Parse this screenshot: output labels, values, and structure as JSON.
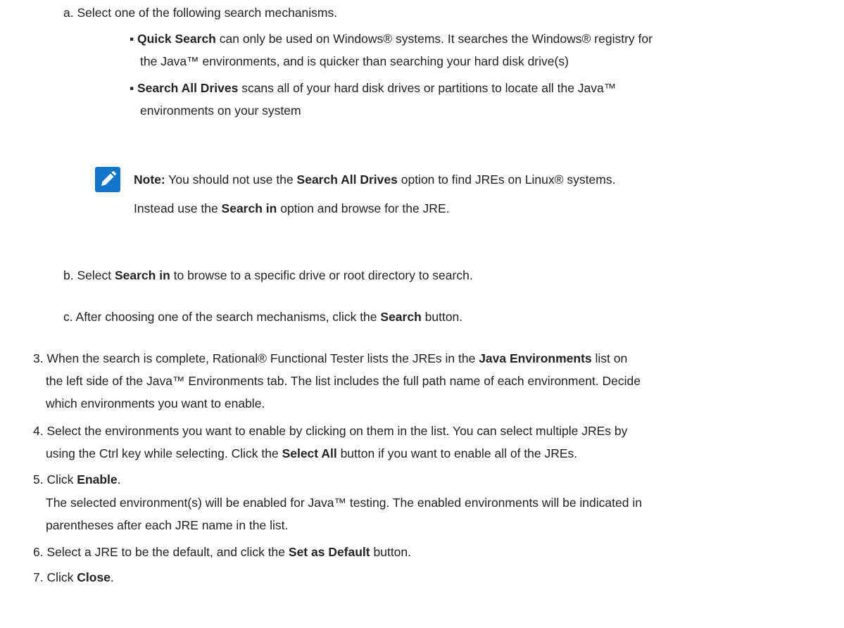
{
  "colors": {
    "text": "#222222",
    "note_icon_bg": "#1576c9"
  },
  "step2_substeps": {
    "a": {
      "marker": "a.",
      "text": "Select one of the following search mechanisms.",
      "options": [
        {
          "term": "Quick Search",
          "line1": " can only be used on Windows® systems. It searches the Windows® registry for",
          "line2": "the Java™ environments, and is quicker than searching your hard disk drive(s)"
        },
        {
          "term": "Search All Drives",
          "line1": " scans all of your hard disk drives or partitions to locate all the Java™",
          "line2": "environments on your system"
        }
      ],
      "note": {
        "icon": "pencil-icon",
        "label": "Note:",
        "t1": " You should not use the ",
        "b1": "Search All Drives",
        "t2": " option to find JREs on Linux® systems.",
        "t3": "Instead use the ",
        "b2": "Search in",
        "t4": " option and browse for the JRE."
      }
    },
    "b": {
      "marker": "b.",
      "t1": "Select ",
      "b1": "Search in",
      "t2": " to browse to a specific drive or root directory to search."
    },
    "c": {
      "marker": "c.",
      "t1": "After choosing one of the search mechanisms, click the ",
      "b1": "Search",
      "t2": " button."
    }
  },
  "steps": {
    "s3": {
      "marker": "3.",
      "t1": "When the search is complete, Rational® Functional Tester lists the JREs in the ",
      "b1": "Java Environments",
      "t2": " list on",
      "line2": "the left side of the Java™ Environments tab. The list includes the full path name of each environment. Decide",
      "line3": "which environments you want to enable."
    },
    "s4": {
      "marker": "4.",
      "line1": "Select the environments you want to enable by clicking on them in the list. You can select multiple JREs by",
      "t1": "using the Ctrl key while selecting. Click the ",
      "b1": "Select All",
      "t2": " button if you want to enable all of the JREs."
    },
    "s5": {
      "marker": "5.",
      "t1": "Click ",
      "b1": "Enable",
      "t2": ".",
      "line2": "The selected environment(s) will be enabled for Java™ testing. The enabled environments will be indicated in",
      "line3": "parentheses after each JRE name in the list."
    },
    "s6": {
      "marker": "6.",
      "t1": "Select a JRE to be the default, and click the ",
      "b1": "Set as Default",
      "t2": " button."
    },
    "s7": {
      "marker": "7.",
      "t1": "Click ",
      "b1": "Close",
      "t2": "."
    }
  }
}
